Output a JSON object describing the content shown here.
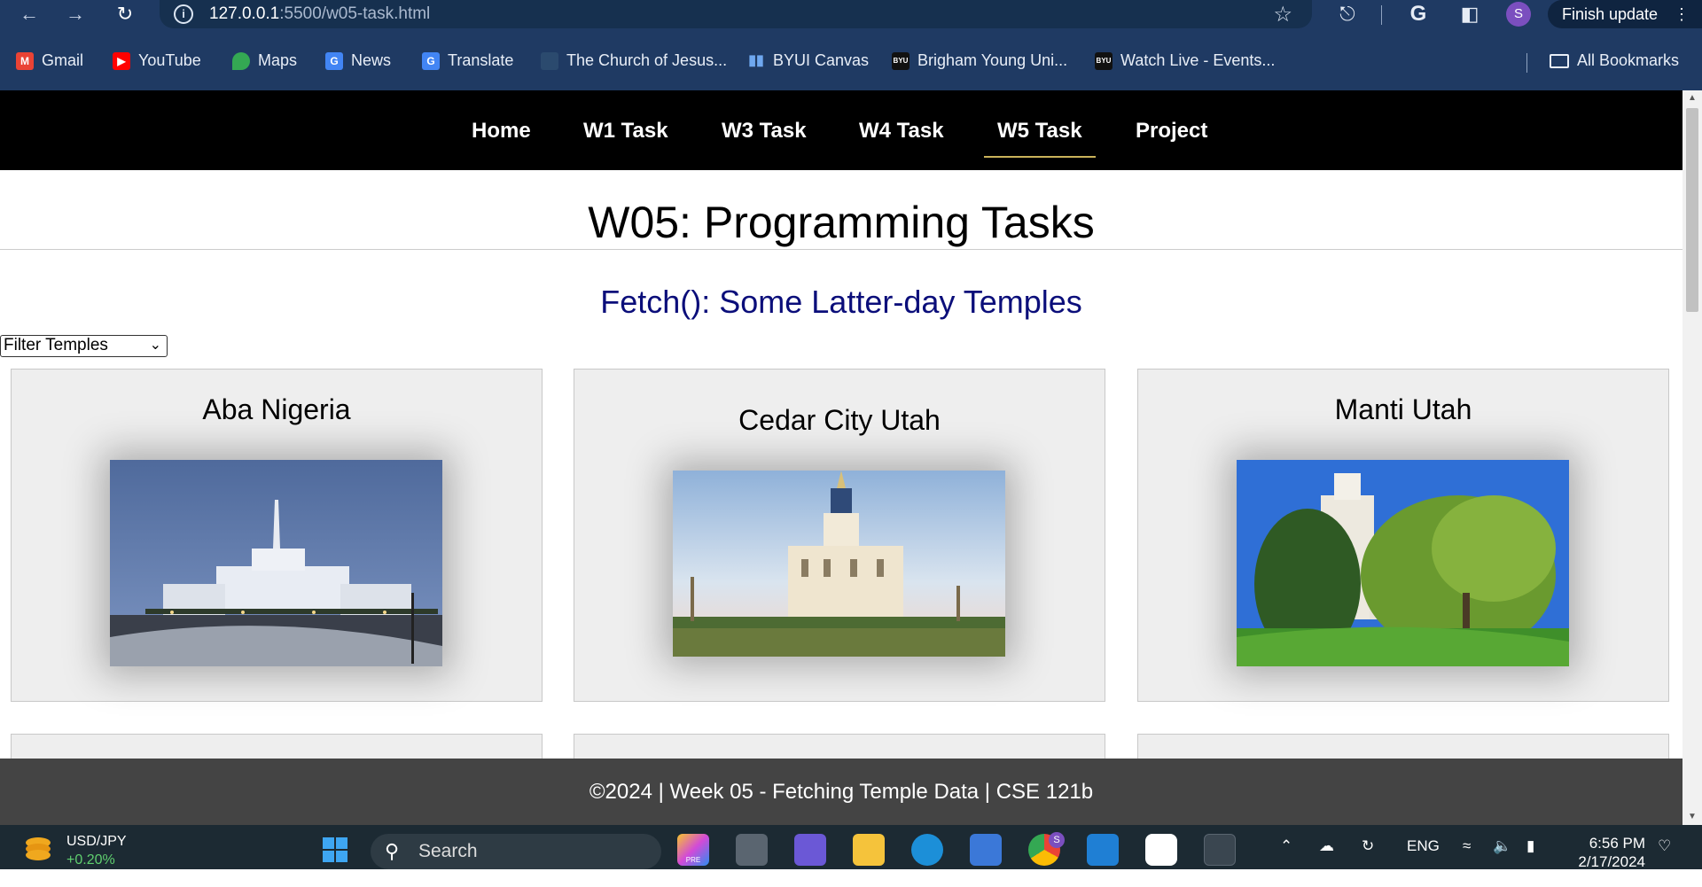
{
  "browser": {
    "url_host": "127.0.0.1",
    "url_path": ":5500/w05-task.html",
    "profile_initial": "S",
    "finish_update_label": "Finish update",
    "bookmarks": [
      {
        "label": "Gmail",
        "icon": "gmail-icon",
        "color": "#ea4335"
      },
      {
        "label": "YouTube",
        "icon": "youtube-icon",
        "color": "#ff0000"
      },
      {
        "label": "Maps",
        "icon": "maps-icon",
        "color": "#34a853"
      },
      {
        "label": "News",
        "icon": "news-icon",
        "color": "#4285f4"
      },
      {
        "label": "Translate",
        "icon": "translate-icon",
        "color": "#4285f4"
      },
      {
        "label": "The Church of Jesus...",
        "icon": "church-icon",
        "color": "#2b4a6e"
      },
      {
        "label": "BYUI Canvas",
        "icon": "canvas-icon",
        "color": "#3c7fd1"
      },
      {
        "label": "Brigham Young Uni...",
        "icon": "byu-icon",
        "color": "#111111"
      },
      {
        "label": "Watch Live - Events...",
        "icon": "byu-icon",
        "color": "#111111"
      }
    ],
    "all_bookmarks_label": "All Bookmarks",
    "byu_badge": "BYU"
  },
  "site": {
    "nav": [
      "Home",
      "W1 Task",
      "W3 Task",
      "W4 Task",
      "W5 Task",
      "Project"
    ],
    "active_nav": "W5 Task",
    "title": "W05: Programming Tasks",
    "subtitle": "Fetch(): Some Latter-day Temples",
    "filter_label": "Filter Temples",
    "temples": [
      {
        "name": "Aba Nigeria"
      },
      {
        "name": "Cedar City Utah"
      },
      {
        "name": "Manti Utah"
      }
    ],
    "footer": "©2024 | Week 05 - Fetching Temple Data | CSE 121b"
  },
  "taskbar": {
    "currency_pair": "USD/JPY",
    "currency_change": "+0.20%",
    "search_placeholder": "Search",
    "pre_badge": "PRE",
    "chrome_profile": "S",
    "language": "ENG",
    "time": "6:56 PM",
    "date": "2/17/2024"
  },
  "colors": {
    "chrome_bg": "#1f3a63",
    "nav_bg": "#000000",
    "subtitle": "#0b0e7a",
    "footer_bg": "#444444",
    "card_bg": "#eeeeee",
    "currency_change": "#5fcf6f"
  }
}
